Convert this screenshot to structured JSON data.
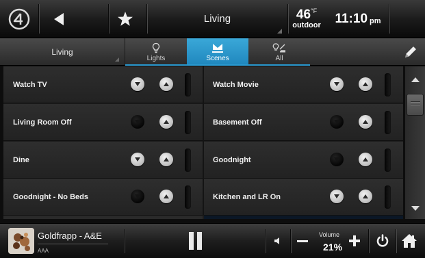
{
  "topbar": {
    "logo_icon": "crestron-logo-icon",
    "back_icon": "back-arrow-icon",
    "favorite_icon": "star-icon",
    "room": "Living",
    "temperature": "46",
    "temp_unit": "°F",
    "temperature_label": "outdoor",
    "time": "11:10",
    "ampm": "pm"
  },
  "tabbar": {
    "room": "Living",
    "tabs": [
      {
        "label": "Lights",
        "icon": "lightbulb-icon",
        "active": false
      },
      {
        "label": "Scenes",
        "icon": "scenes-icon",
        "active": true
      },
      {
        "label": "All",
        "icon": "all-lights-icon",
        "active": false
      }
    ],
    "edit_icon": "pencil-icon",
    "accent": "#2a9ad0"
  },
  "scenes": [
    {
      "name": "Watch TV",
      "down_active": true,
      "up_active": true
    },
    {
      "name": "Watch Movie",
      "down_active": true,
      "up_active": true
    },
    {
      "name": "Living Room Off",
      "down_active": false,
      "up_active": true
    },
    {
      "name": "Basement Off",
      "down_active": false,
      "up_active": true
    },
    {
      "name": "Dine",
      "down_active": true,
      "up_active": true
    },
    {
      "name": "Goodnight",
      "down_active": false,
      "up_active": true
    },
    {
      "name": "Goodnight - No Beds",
      "down_active": false,
      "up_active": true
    },
    {
      "name": "Kitchen and LR On",
      "down_active": true,
      "up_active": true
    }
  ],
  "player": {
    "track": "Goldfrapp - A&E",
    "album": "AAA",
    "pause_icon": "pause-icon",
    "mute_icon": "speaker-icon",
    "volume_label": "Volume",
    "volume_value": "21%",
    "power_icon": "power-icon",
    "home_icon": "home-icon"
  }
}
